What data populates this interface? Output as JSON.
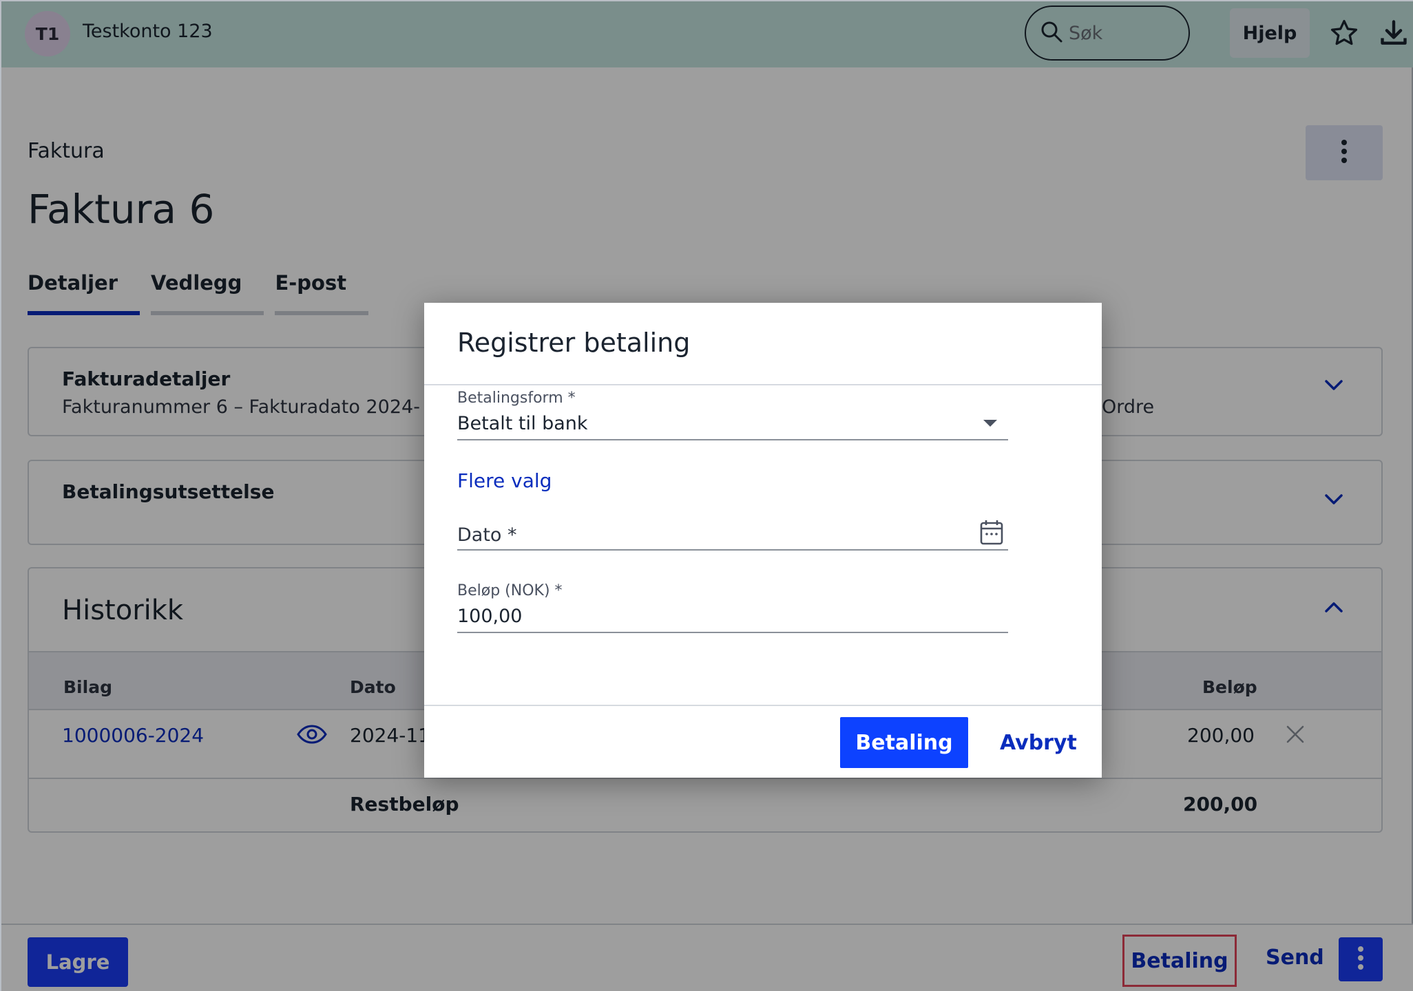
{
  "header": {
    "avatar_initials": "T1",
    "account_name": "Testkonto 123",
    "search_placeholder": "Søk",
    "help_label": "Hjelp",
    "icons": [
      "search-icon",
      "star-icon",
      "download-icon"
    ]
  },
  "page": {
    "breadcrumb": "Faktura",
    "title": "Faktura 6",
    "tabs": [
      {
        "label": "Detaljer",
        "active": true
      },
      {
        "label": "Vedlegg",
        "active": false
      },
      {
        "label": "E-post",
        "active": false
      }
    ]
  },
  "sections": {
    "details": {
      "title": "Fakturadetaljer",
      "summary": "Fakturanummer 6  –  Fakturadato 2024-",
      "summary_right": "Ordre"
    },
    "deferral": {
      "title": "Betalingsutsettelse"
    },
    "history": {
      "title": "Historikk",
      "columns": {
        "bilag": "Bilag",
        "dato": "Dato",
        "belop": "Beløp"
      },
      "rows": [
        {
          "bilag": "1000006-2024",
          "dato": "2024-11",
          "belop": "200,00"
        }
      ],
      "rest_label": "Restbeløp",
      "rest_value": "200,00"
    }
  },
  "modal": {
    "title": "Registrer betaling",
    "payment_method_label": "Betalingsform *",
    "payment_method_value": "Betalt til bank",
    "more_options": "Flere valg",
    "date_label": "Dato *",
    "amount_label": "Beløp (NOK) *",
    "amount_value": "100,00",
    "confirm_label": "Betaling",
    "cancel_label": "Avbryt"
  },
  "footer": {
    "save_label": "Lagre",
    "payment_label": "Betaling",
    "send_label": "Send"
  },
  "colors": {
    "topbar": "#c5e6e0",
    "primary": "#1a3df5",
    "link": "#0a2dbd",
    "highlight_border": "#e2455a"
  }
}
